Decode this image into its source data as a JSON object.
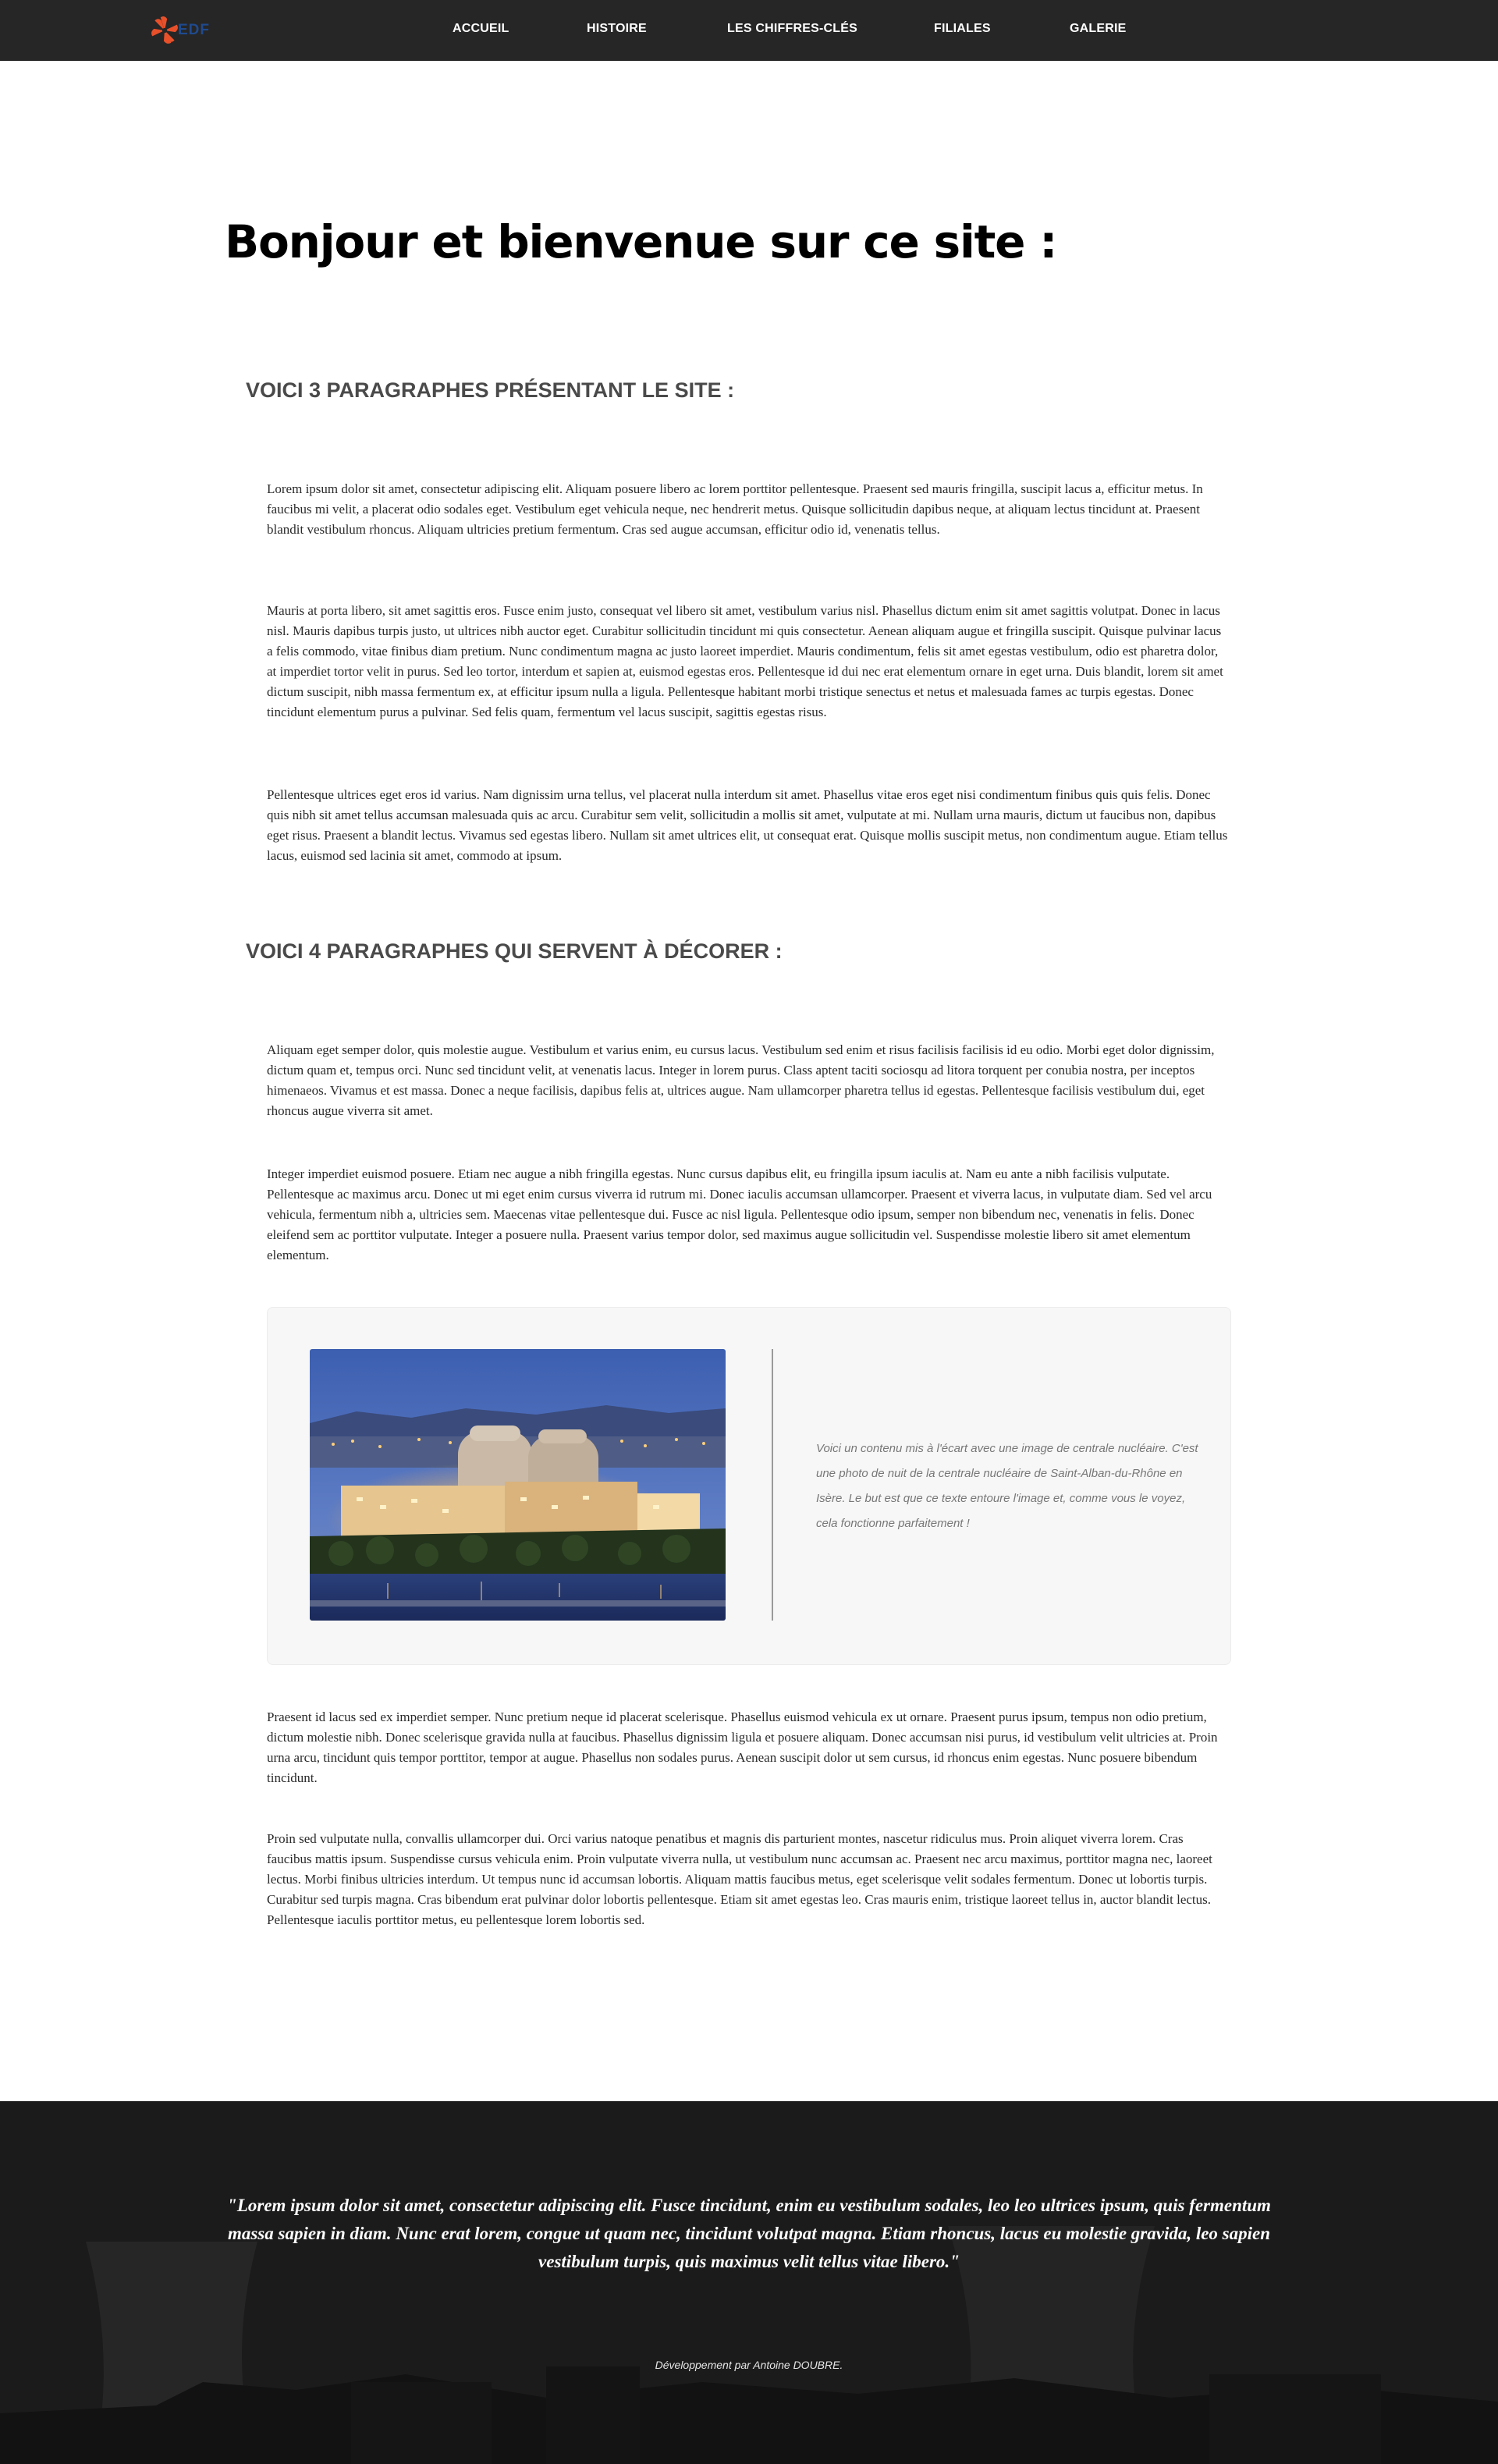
{
  "nav": {
    "logo_text": "EDF",
    "links": [
      "ACCUEIL",
      "HISTOIRE",
      "LES CHIFFRES-CLÉS",
      "FILIALES",
      "GALERIE"
    ]
  },
  "main": {
    "title": "Bonjour et bienvenue sur ce site :",
    "section1": {
      "heading": "VOICI 3 PARAGRAPHES PRÉSENTANT LE SITE :",
      "paragraphs": [
        "Lorem ipsum dolor sit amet, consectetur adipiscing elit. Aliquam posuere libero ac lorem porttitor pellentesque. Praesent sed mauris fringilla, suscipit lacus a, efficitur metus. In faucibus mi velit, a placerat odio sodales eget. Vestibulum eget vehicula neque, nec hendrerit metus. Quisque sollicitudin dapibus neque, at aliquam lectus tincidunt at. Praesent blandit vestibulum rhoncus. Aliquam ultricies pretium fermentum. Cras sed augue accumsan, efficitur odio id, venenatis tellus.",
        "Mauris at porta libero, sit amet sagittis eros. Fusce enim justo, consequat vel libero sit amet, vestibulum varius nisl. Phasellus dictum enim sit amet sagittis volutpat. Donec in lacus nisl. Mauris dapibus turpis justo, ut ultrices nibh auctor eget. Curabitur sollicitudin tincidunt mi quis consectetur. Aenean aliquam augue et fringilla suscipit. Quisque pulvinar lacus a felis commodo, vitae finibus diam pretium. Nunc condimentum magna ac justo laoreet imperdiet. Mauris condimentum, felis sit amet egestas vestibulum, odio est pharetra dolor, at imperdiet tortor velit in purus. Sed leo tortor, interdum et sapien at, euismod egestas eros. Pellentesque id dui nec erat elementum ornare in eget urna. Duis blandit, lorem sit amet dictum suscipit, nibh massa fermentum ex, at efficitur ipsum nulla a ligula. Pellentesque habitant morbi tristique senectus et netus et malesuada fames ac turpis egestas. Donec tincidunt elementum purus a pulvinar. Sed felis quam, fermentum vel lacus suscipit, sagittis egestas risus.",
        "Pellentesque ultrices eget eros id varius. Nam dignissim urna tellus, vel placerat nulla interdum sit amet. Phasellus vitae eros eget nisi condimentum finibus quis quis felis. Donec quis nibh sit amet tellus accumsan malesuada quis ac arcu. Curabitur sem velit, sollicitudin a mollis sit amet, vulputate at mi. Nullam urna mauris, dictum ut faucibus non, dapibus eget risus. Praesent a blandit lectus. Vivamus sed egestas libero. Nullam sit amet ultrices elit, ut consequat erat. Quisque mollis suscipit metus, non condimentum augue. Etiam tellus lacus, euismod sed lacinia sit amet, commodo at ipsum."
      ]
    },
    "section2": {
      "heading": "VOICI 4 PARAGRAPHES QUI SERVENT À DÉCORER :",
      "paragraphs": [
        "Aliquam eget semper dolor, quis molestie augue. Vestibulum et varius enim, eu cursus lacus. Vestibulum sed enim et risus facilisis facilisis id eu odio. Morbi eget dolor dignissim, dictum quam et, tempus orci. Nunc sed tincidunt velit, at venenatis lacus. Integer in lorem purus. Class aptent taciti sociosqu ad litora torquent per conubia nostra, per inceptos himenaeos. Vivamus et est massa. Donec a neque facilisis, dapibus felis at, ultrices augue. Nam ullamcorper pharetra tellus id egestas. Pellentesque facilisis vestibulum dui, eget rhoncus augue viverra sit amet.",
        "Integer imperdiet euismod posuere. Etiam nec augue a nibh fringilla egestas. Nunc cursus dapibus elit, eu fringilla ipsum iaculis at. Nam eu ante a nibh facilisis vulputate. Pellentesque ac maximus arcu. Donec ut mi eget enim cursus viverra id rutrum mi. Donec iaculis accumsan ullamcorper. Praesent et viverra lacus, in vulputate diam. Sed vel arcu vehicula, fermentum nibh a, ultricies sem. Maecenas vitae pellentesque dui. Fusce ac nisl ligula. Pellentesque odio ipsum, semper non bibendum nec, venenatis in felis. Donec eleifend sem ac porttitor vulputate. Integer a posuere nulla. Praesent varius tempor dolor, sed maximus augue sollicitudin vel. Suspendisse molestie libero sit amet elementum elementum.",
        "Praesent id lacus sed ex imperdiet semper. Nunc pretium neque id placerat scelerisque. Phasellus euismod vehicula ex ut ornare. Praesent purus ipsum, tempus non odio pretium, dictum molestie nibh. Donec scelerisque gravida nulla at faucibus. Phasellus dignissim ligula et posuere aliquam. Donec accumsan nisi purus, id vestibulum velit ultricies at. Proin urna arcu, tincidunt quis tempor porttitor, tempor at augue. Phasellus non sodales purus. Aenean suscipit dolor ut sem cursus, id rhoncus enim egestas. Nunc posuere bibendum tincidunt.",
        "Proin sed vulputate nulla, convallis ullamcorper dui. Orci varius natoque penatibus et magnis dis parturient montes, nascetur ridiculus mus. Proin aliquet viverra lorem. Cras faucibus mattis ipsum. Suspendisse cursus vehicula enim. Proin vulputate viverra nulla, ut vestibulum nunc accumsan ac. Praesent nec arcu maximus, porttitor magna nec, laoreet lectus. Morbi finibus ultricies interdum. Ut tempus nunc id accumsan lobortis. Aliquam mattis faucibus metus, eget scelerisque velit sodales fermentum. Donec ut lobortis turpis. Curabitur sed turpis magna. Cras bibendum erat pulvinar dolor lobortis pellentesque. Etiam sit amet egestas leo. Cras mauris enim, tristique laoreet tellus in, auctor blandit lectus. Pellentesque iaculis porttitor metus, eu pellentesque lorem lobortis sed."
      ]
    },
    "feature": {
      "caption": "Voici un contenu mis à l'écart avec une image de centrale nucléaire. C'est une photo de nuit de la centrale nucléaire de Saint-Alban-du-Rhône en Isère. Le but est que ce texte entoure l'image et, comme vous le voyez, cela fonctionne parfaitement !"
    }
  },
  "footer": {
    "quote": "\"Lorem ipsum dolor sit amet, consectetur adipiscing elit. Fusce tincidunt, enim eu vestibulum sodales, leo leo ultrices ipsum, quis fermentum massa sapien in diam. Nunc erat lorem, congue ut quam nec, tincidunt volutpat magna. Etiam rhoncus, lacus eu molestie gravida, leo sapien vestibulum turpis, quis maximus velit tellus vitae libero.\"",
    "credit": "Développement par Antoine DOUBRE."
  },
  "colors": {
    "nav_bg": "#262626",
    "logo_orange": "#e8502a",
    "logo_blue": "#1f4a8f",
    "heading_gray": "#4a4a4a",
    "footer_bg": "#191919",
    "feature_bg": "#f7f7f7"
  }
}
